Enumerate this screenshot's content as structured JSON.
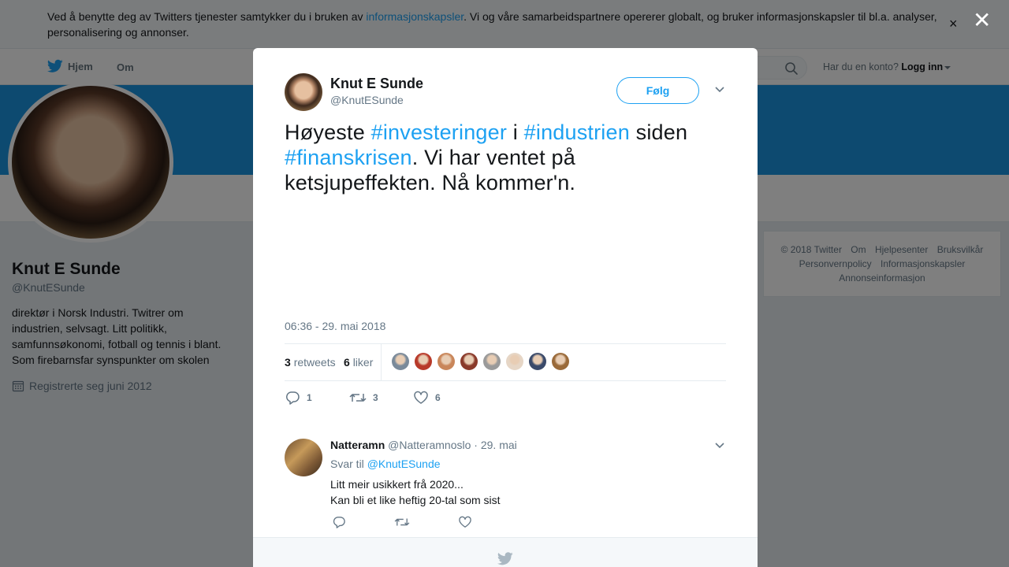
{
  "cookie_bar": {
    "text_before": "Ved å benytte deg av Twitters tjenester samtykker du i bruken av ",
    "link": "informasjonskapsler",
    "text_after": ". Vi og våre samarbeidspartnere opererer globalt, og bruker informasjonskapsler til bl.a. analyser, personalisering og annonser.",
    "close": "×"
  },
  "nav": {
    "home": "Hjem",
    "about": "Om",
    "account_question": "Har du en konto?",
    "login": "Logg inn"
  },
  "profile": {
    "name": "Knut E Sunde",
    "handle": "@KnutESunde",
    "bio": "direktør i Norsk Industri. Twitrer om industrien, selvsagt. Litt politikk, samfunnsøkonomi, fotball og tennis i blant. Som firebarnsfar synspunkter om skolen",
    "joined": "Registrerte seg juni 2012"
  },
  "footer": {
    "items": [
      "© 2018 Twitter",
      "Om",
      "Hjelpesenter",
      "Bruksvilkår",
      "Personvernpolicy",
      "Informasjonskapsler",
      "Annonseinformasjon"
    ]
  },
  "overlay_close": "✕",
  "tweet": {
    "author_name": "Knut E Sunde",
    "author_handle": "@KnutESunde",
    "follow_label": "Følg",
    "text_parts": [
      {
        "t": "Høyeste ",
        "hashtag": false
      },
      {
        "t": "#investeringer",
        "hashtag": true
      },
      {
        "t": " i ",
        "hashtag": false
      },
      {
        "t": "#industrien",
        "hashtag": true
      },
      {
        "t": " siden ",
        "hashtag": false
      },
      {
        "t": "#finanskrisen",
        "hashtag": true
      },
      {
        "t": ". Vi har ventet på ketsjupeffekten. Nå kommer'n.",
        "hashtag": false
      }
    ],
    "timestamp": "06:36 - 29. mai 2018",
    "retweets_count": "3",
    "retweets_label": "retweets",
    "likes_count": "6",
    "likes_label": "liker",
    "actions": {
      "reply_count": "1",
      "retweet_count": "3",
      "like_count": "6"
    },
    "liker_colors": [
      "#7a8a9a",
      "#b83a2a",
      "#c9865a",
      "#8a3a2a",
      "#9a9a9a",
      "#e6d6c6",
      "#3a4a6a",
      "#9a6a3a"
    ]
  },
  "reply": {
    "name": "Natteramn",
    "handle": "@Natteramnoslo",
    "separator": "·",
    "date": "29. mai",
    "reply_to_label": "Svar til",
    "reply_to_handle": "@KnutESunde",
    "line1": "Litt meir usikkert frå 2020...",
    "line2": "Kan bli et like heftig 20-tal som sist"
  },
  "colors": {
    "accent": "#1da1f2",
    "banner": "#1b95e0",
    "muted": "#657786"
  }
}
